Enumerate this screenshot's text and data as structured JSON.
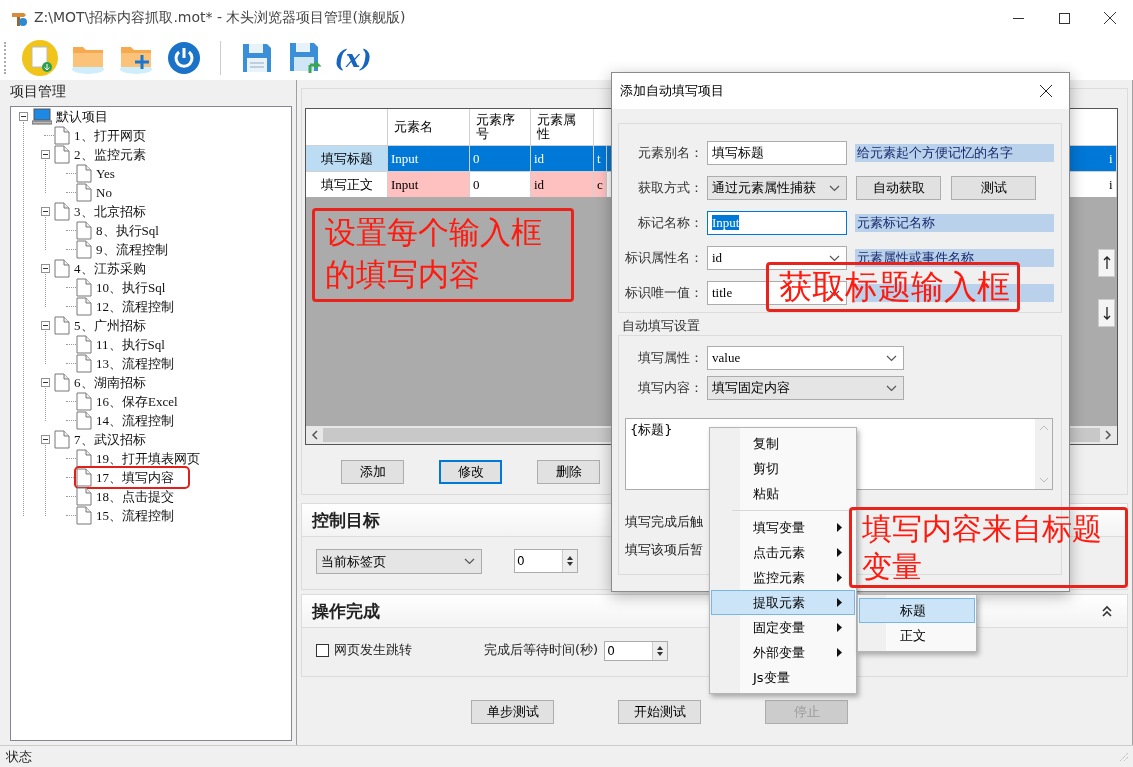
{
  "window": {
    "title": "Z:\\MOT\\招标内容抓取.mot* - 木头浏览器项目管理(旗舰版)"
  },
  "toolbar": [
    {
      "kind": "new"
    },
    {
      "kind": "open"
    },
    {
      "kind": "import"
    },
    {
      "kind": "power"
    },
    {
      "kind": "separator"
    },
    {
      "kind": "save"
    },
    {
      "kind": "save_as"
    },
    {
      "kind": "variable",
      "label": "(x)"
    }
  ],
  "project_panel": {
    "title": "项目管理",
    "tree": [
      {
        "label": "默认项目",
        "kind": "computer",
        "expanded": true,
        "annotated": false,
        "children": [
          {
            "label": "1、打开网页",
            "kind": "page",
            "annotated": false
          },
          {
            "label": "2、监控元素",
            "kind": "page",
            "expanded": true,
            "annotated": false,
            "children": [
              {
                "label": "Yes",
                "kind": "page",
                "annotated": false
              },
              {
                "label": "No",
                "kind": "page",
                "annotated": false
              }
            ]
          },
          {
            "label": "3、北京招标",
            "kind": "page",
            "expanded": true,
            "annotated": false,
            "children": [
              {
                "label": "8、执行Sql",
                "kind": "page",
                "annotated": false
              },
              {
                "label": "9、流程控制",
                "kind": "page",
                "annotated": false
              }
            ]
          },
          {
            "label": "4、江苏采购",
            "kind": "page",
            "expanded": true,
            "annotated": false,
            "children": [
              {
                "label": "10、执行Sql",
                "kind": "page",
                "annotated": false
              },
              {
                "label": "12、流程控制",
                "kind": "page",
                "annotated": false
              }
            ]
          },
          {
            "label": "5、广州招标",
            "kind": "page",
            "expanded": true,
            "annotated": false,
            "children": [
              {
                "label": "11、执行Sql",
                "kind": "page",
                "annotated": false
              },
              {
                "label": "13、流程控制",
                "kind": "page",
                "annotated": false
              }
            ]
          },
          {
            "label": "6、湖南招标",
            "kind": "page",
            "expanded": true,
            "annotated": false,
            "children": [
              {
                "label": "16、保存Excel",
                "kind": "page",
                "annotated": false
              },
              {
                "label": "14、流程控制",
                "kind": "page",
                "annotated": false
              }
            ]
          },
          {
            "label": "7、武汉招标",
            "kind": "page",
            "expanded": true,
            "annotated": false,
            "children": [
              {
                "label": "19、打开填表网页",
                "kind": "page",
                "annotated": false
              },
              {
                "label": "17、填写内容",
                "kind": "page",
                "annotated": true
              },
              {
                "label": "18、点击提交",
                "kind": "page",
                "annotated": false
              },
              {
                "label": "15、流程控制",
                "kind": "page",
                "annotated": false
              }
            ]
          }
        ]
      }
    ]
  },
  "grid": {
    "columns": [
      {
        "label": "元素名"
      },
      {
        "label": "元素序号"
      },
      {
        "label": "元素属性"
      }
    ],
    "rows": [
      {
        "header": "填写标题",
        "selected": true,
        "cells": [
          {
            "text": "Input",
            "highlight": false
          },
          {
            "text": "0",
            "highlight": false
          },
          {
            "text": "id",
            "highlight": false
          },
          {
            "text": "t",
            "highlight": false
          },
          {
            "text": "i",
            "highlight": false
          }
        ]
      },
      {
        "header": "填写正文",
        "selected": false,
        "cells": [
          {
            "text": "Input",
            "highlight": true
          },
          {
            "text": "0",
            "highlight": false
          },
          {
            "text": "id",
            "highlight": true
          },
          {
            "text": "c",
            "highlight": true
          },
          {
            "text": "i",
            "highlight": false
          }
        ]
      }
    ]
  },
  "grid_buttons": [
    {
      "label": "添加",
      "focused": false
    },
    {
      "label": "修改",
      "focused": true
    },
    {
      "label": "删除",
      "focused": false
    }
  ],
  "control_target": {
    "title": "控制目标",
    "collapsible": false,
    "target": "当前标签页",
    "index": "0"
  },
  "completion": {
    "title": "操作完成",
    "collapsible": true,
    "navigate": {
      "label": "网页发生跳转",
      "checked": false
    },
    "wait_label": "完成后等待时间(秒)",
    "wait": "0"
  },
  "test_buttons": [
    {
      "label": "单步测试",
      "disabled": false
    },
    {
      "label": "开始测试",
      "disabled": false
    },
    {
      "label": "停止",
      "disabled": true
    }
  ],
  "dialog": {
    "title": "添加自动填写项目",
    "fields": [
      {
        "label": "元素别名：",
        "kind": "text",
        "value": "填写标题",
        "value_selected": false,
        "hint": "给元素起个方便记忆的名字"
      },
      {
        "label": "获取方式：",
        "kind": "dropdown",
        "value": "通过元素属性捕获",
        "buttons": [
          "自动获取",
          "测试"
        ]
      },
      {
        "label": "标记名称：",
        "kind": "text",
        "value": "Input",
        "value_selected": true,
        "hint": "元素标记名称"
      },
      {
        "label": "标识属性名：",
        "kind": "combo",
        "value": "id",
        "hint": "元素属性或事件名称"
      },
      {
        "label": "标识唯一值：",
        "kind": "combo",
        "value": "title"
      }
    ],
    "fill": {
      "title": "自动填写设置",
      "fields": [
        {
          "label": "填写属性：",
          "kind": "combo",
          "value": "value"
        },
        {
          "label": "填写内容：",
          "kind": "dropdown",
          "value": "填写固定内容"
        }
      ],
      "content": "{标题}",
      "options": [
        {
          "label": "填写完成后触"
        },
        {
          "label": "填写该项后暂"
        }
      ]
    }
  },
  "context_menu": {
    "items": [
      {
        "kind": "item",
        "label": "复制",
        "submenu": false,
        "selected": false
      },
      {
        "kind": "item",
        "label": "剪切",
        "submenu": false,
        "selected": false
      },
      {
        "kind": "item",
        "label": "粘贴",
        "submenu": false,
        "selected": false
      },
      {
        "kind": "separator"
      },
      {
        "kind": "item",
        "label": "填写变量",
        "submenu": true,
        "selected": false
      },
      {
        "kind": "item",
        "label": "点击元素",
        "submenu": true,
        "selected": false
      },
      {
        "kind": "item",
        "label": "监控元素",
        "submenu": true,
        "selected": false
      },
      {
        "kind": "item",
        "label": "提取元素",
        "submenu": true,
        "selected": true
      },
      {
        "kind": "item",
        "label": "固定变量",
        "submenu": true,
        "selected": false
      },
      {
        "kind": "item",
        "label": "外部变量",
        "submenu": true,
        "selected": false
      },
      {
        "kind": "item",
        "label": "Js变量",
        "submenu": false,
        "selected": false
      }
    ],
    "submenu": [
      {
        "label": "标题",
        "selected": true
      },
      {
        "label": "正文",
        "selected": false
      }
    ]
  },
  "callouts": [
    {
      "text": "设置每个输入框的填写内容"
    },
    {
      "text": "获取标题输入框"
    },
    {
      "text": "填写内容来自标题变量"
    }
  ],
  "status_bar": {
    "text": "状态"
  }
}
